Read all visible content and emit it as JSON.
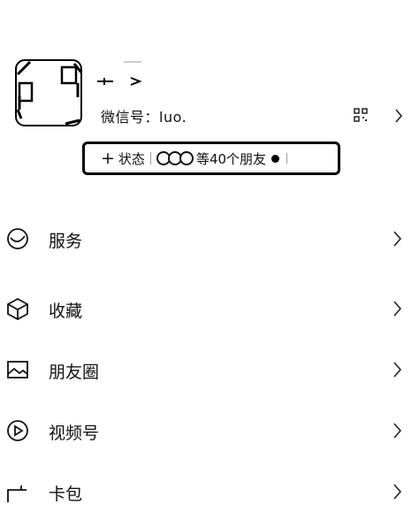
{
  "profile": {
    "wechat_id": "微信号：luo.",
    "status_add": "状态",
    "friends_summary": "等40个朋友"
  },
  "menu": [
    {
      "label": "服务",
      "icon": "service-icon"
    },
    {
      "label": "收藏",
      "icon": "favorites-cube-icon"
    },
    {
      "label": "朋友圈",
      "icon": "moments-picture-icon"
    },
    {
      "label": "视频号",
      "icon": "channels-play-icon"
    },
    {
      "label": "卡包",
      "icon": "card-wallet-icon"
    }
  ]
}
